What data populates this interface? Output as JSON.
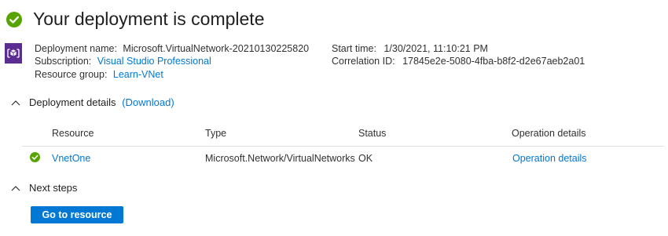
{
  "header": {
    "title": "Your deployment is complete",
    "status_icon": "success-check-icon",
    "app_icon": "deployment-cube-icon"
  },
  "summary": {
    "deployment_name_label": "Deployment name:",
    "deployment_name": "Microsoft.VirtualNetwork-20210130225820",
    "subscription_label": "Subscription:",
    "subscription": "Visual Studio Professional",
    "resource_group_label": "Resource group:",
    "resource_group": "Learn-VNet",
    "start_time_label": "Start time:",
    "start_time": "1/30/2021, 11:10:21 PM",
    "correlation_id_label": "Correlation ID:",
    "correlation_id": "17845e2e-5080-4fba-b8f2-d2e67aeb2a01"
  },
  "deployment_details": {
    "title": "Deployment details",
    "download_link": "(Download)",
    "columns": [
      "Resource",
      "Type",
      "Status",
      "Operation details"
    ],
    "rows": [
      {
        "resource": "VnetOne",
        "type": "Microsoft.Network/VirtualNetworks",
        "status": "OK",
        "operation_details": "Operation details"
      }
    ]
  },
  "next_steps": {
    "title": "Next steps",
    "button_label": "Go to resource"
  },
  "colors": {
    "accent": "#0078d4",
    "success": "#57a300",
    "app_icon_bg": "#5c2d91"
  }
}
